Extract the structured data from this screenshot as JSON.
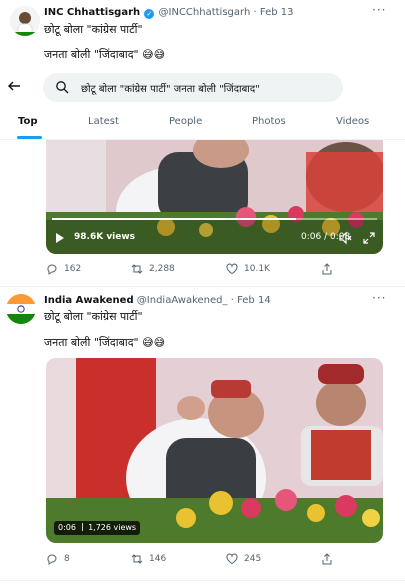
{
  "tweet1": {
    "name": "INC Chhattisgarh",
    "handle": "@INCChhattisgarh",
    "date": "Feb 13",
    "line1": "छोटू बोला \"कांग्रेस पार्टी\"",
    "line2": "जनता बोली \"जिंदाबाद\" 😅😅",
    "views": "98.6K views",
    "time": "0:06 / 0:08",
    "replies": "162",
    "retweets": "2,288",
    "likes": "10.1K"
  },
  "search": {
    "query": "छोटू बोला \"कांग्रेस पार्टी\"  जनता बोली \"जिंदाबाद\"",
    "tabs": [
      "Top",
      "Latest",
      "People",
      "Photos",
      "Videos"
    ],
    "active_tab": "Top"
  },
  "tweet2": {
    "name": "India Awakened",
    "handle": "@IndiaAwakened_",
    "date": "Feb 14",
    "line1": "छोटू बोला \"कांग्रेस पार्टी\"",
    "line2": "जनता बोली \"जिंदाबाद\" 😅😅",
    "time": "0:06",
    "views": "1,726 views",
    "replies": "8",
    "retweets": "146",
    "likes": "245"
  },
  "colors": {
    "accent": "#1d9bf0",
    "muted": "#536471"
  }
}
